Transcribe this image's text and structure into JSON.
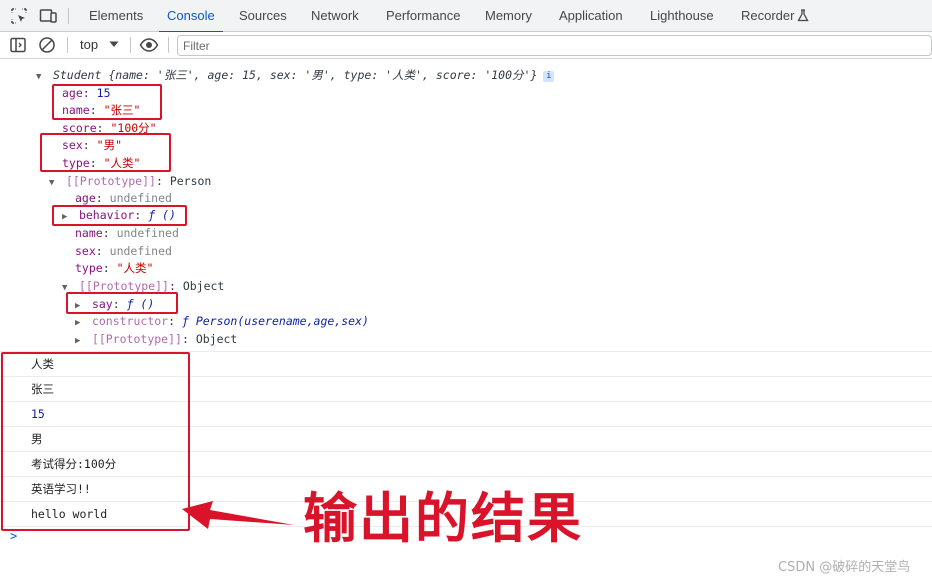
{
  "tabs": [
    {
      "label": "Elements"
    },
    {
      "label": "Console"
    },
    {
      "label": "Sources"
    },
    {
      "label": "Network"
    },
    {
      "label": "Performance"
    },
    {
      "label": "Memory"
    },
    {
      "label": "Application"
    },
    {
      "label": "Lighthouse"
    },
    {
      "label": "Recorder"
    }
  ],
  "active_tab": "Console",
  "toolbar": {
    "context": "top",
    "filter_placeholder": "Filter"
  },
  "tree": {
    "head_name": "Student",
    "head_preview": "{name: '张三', age: 15, sex: '男', type: '人类', score: '100分'}",
    "own_props": [
      {
        "key": "age",
        "value": "15",
        "kind": "number"
      },
      {
        "key": "name",
        "value": "\"张三\"",
        "kind": "string"
      },
      {
        "key": "score",
        "value": "\"100分\"",
        "kind": "string"
      },
      {
        "key": "sex",
        "value": "\"男\"",
        "kind": "string"
      },
      {
        "key": "type",
        "value": "\"人类\"",
        "kind": "string"
      }
    ],
    "proto1_label": "[[Prototype]]",
    "proto1_value": "Person",
    "proto1_props": [
      {
        "key": "age",
        "value": "undefined"
      },
      {
        "key": "behavior",
        "value": "ƒ ()"
      },
      {
        "key": "name",
        "value": "undefined"
      },
      {
        "key": "sex",
        "value": "undefined"
      },
      {
        "key": "type",
        "value": "\"人类\""
      }
    ],
    "proto2_label": "[[Prototype]]",
    "proto2_value": "Object",
    "proto2_props": [
      {
        "key": "say",
        "value": "ƒ ()"
      },
      {
        "key": "constructor",
        "value": "ƒ Person(userename,age,sex)"
      },
      {
        "key": "[[Prototype]]",
        "value": "Object"
      }
    ]
  },
  "logs": [
    {
      "text": "人类"
    },
    {
      "text": "张三"
    },
    {
      "text": "15"
    },
    {
      "text": "男"
    },
    {
      "text": "考试得分:100分"
    },
    {
      "text": "英语学习!!"
    },
    {
      "text": "hello world"
    }
  ],
  "prompt": ">",
  "annotation": {
    "text": "输出的结果",
    "color": "#d9142a"
  },
  "watermark": "CSDN @破碎的天堂鸟"
}
